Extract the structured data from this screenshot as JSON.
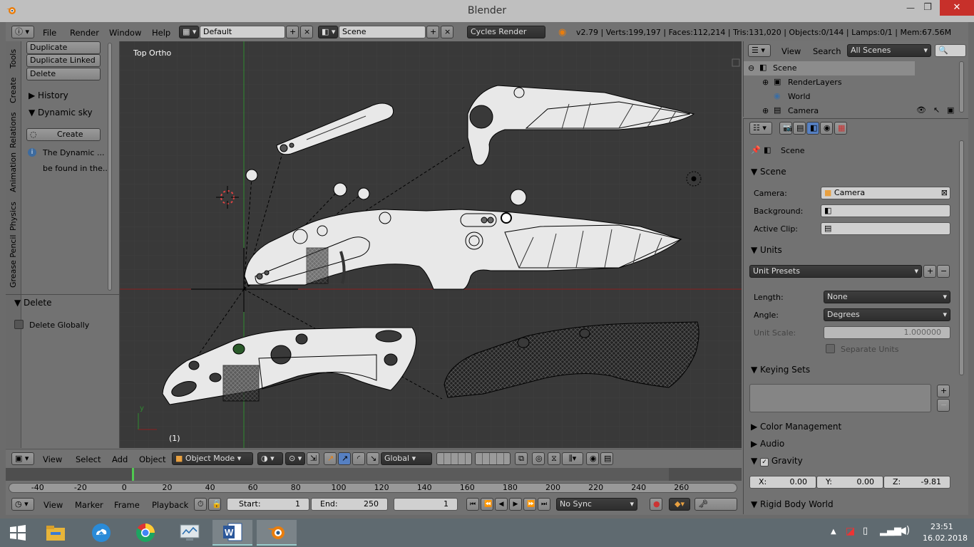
{
  "window": {
    "title": "Blender",
    "controls": [
      "—",
      "❐",
      "✕"
    ]
  },
  "info_header": {
    "menus": [
      "File",
      "Render",
      "Window",
      "Help"
    ],
    "layout": "Default",
    "scene": "Scene",
    "engine": "Cycles Render",
    "stats": "v2.79 | Verts:199,197 | Faces:112,214 | Tris:131,020 | Objects:0/144 | Lamps:0/1 | Mem:67.56M"
  },
  "toolshelf": {
    "tabs": [
      "Tools",
      "Create",
      "Relations",
      "Animation",
      "Physics",
      "Grease Pencil"
    ],
    "buttons": [
      "Duplicate",
      "Duplicate Linked",
      "Delete"
    ],
    "panels": {
      "history": "History",
      "dynamic_sky": "Dynamic sky"
    },
    "create_label": "Create",
    "info_line1": "The Dynamic ...",
    "info_line2": "be found in the...",
    "operator_title": "Delete",
    "delete_globally": "Delete Globally"
  },
  "viewport": {
    "label": "Top Ortho",
    "frame": "(1)",
    "axis_y": "y"
  },
  "view3d_header": {
    "menus": [
      "View",
      "Select",
      "Add",
      "Object"
    ],
    "mode": "Object Mode",
    "orientation": "Global"
  },
  "timeline": {
    "ruler": [
      "-40",
      "-20",
      "0",
      "20",
      "40",
      "60",
      "80",
      "100",
      "120",
      "140",
      "160",
      "180",
      "200",
      "220",
      "240",
      "260"
    ],
    "menus": [
      "View",
      "Marker",
      "Frame",
      "Playback"
    ],
    "start_label": "Start:",
    "start_value": "1",
    "end_label": "End:",
    "end_value": "250",
    "current": "1",
    "sync": "No Sync"
  },
  "outliner": {
    "menus": [
      "View",
      "Search"
    ],
    "filter": "All Scenes",
    "items": [
      "Scene",
      "RenderLayers",
      "World",
      "Camera"
    ]
  },
  "properties": {
    "context": "Scene",
    "scene_panel": "Scene",
    "camera_label": "Camera:",
    "camera_value": "Camera",
    "background_label": "Background:",
    "clip_label": "Active Clip:",
    "units_panel": "Units",
    "unit_presets": "Unit Presets",
    "length_label": "Length:",
    "length_value": "None",
    "angle_label": "Angle:",
    "angle_value": "Degrees",
    "scale_label": "Unit Scale:",
    "scale_value": "1.000000",
    "separate_units": "Separate Units",
    "keying_sets": "Keying Sets",
    "color_management": "Color Management",
    "audio": "Audio",
    "gravity": "Gravity",
    "gx_label": "X:",
    "gx": "0.00",
    "gy_label": "Y:",
    "gy": "0.00",
    "gz_label": "Z:",
    "gz": "-9.81",
    "rigid_body": "Rigid Body World"
  },
  "taskbar": {
    "time": "23:51",
    "date": "16.02.2018"
  },
  "colors": {
    "accent_orange": "#e87d0d",
    "x_axis": "#8c1e1e",
    "y_axis": "#2e8c2e"
  }
}
